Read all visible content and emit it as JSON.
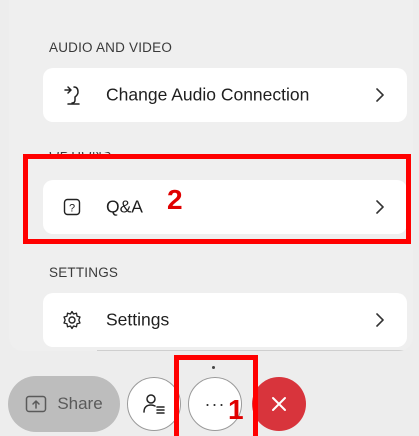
{
  "sections": {
    "audio_video": {
      "label": "AUDIO AND VIDEO",
      "item_label": "Change Audio Connection",
      "item_icon": "audio-connection-icon"
    },
    "options": {
      "label": "OPTIONS",
      "item_label": "Q&A",
      "item_icon": "question-box-icon"
    },
    "settings": {
      "label": "SETTINGS",
      "item_label": "Settings",
      "item_icon": "gear-icon"
    }
  },
  "controls": {
    "share_label": "Share",
    "share_icon": "share-screen-icon",
    "participants_icon": "participants-icon",
    "more_label": "···",
    "end_icon": "close-icon"
  },
  "annotations": {
    "step1": "1",
    "step2": "2",
    "highlight_color": "#ff0000"
  },
  "colors": {
    "end_call": "#d8343c",
    "panel_bg": "#efefef"
  }
}
